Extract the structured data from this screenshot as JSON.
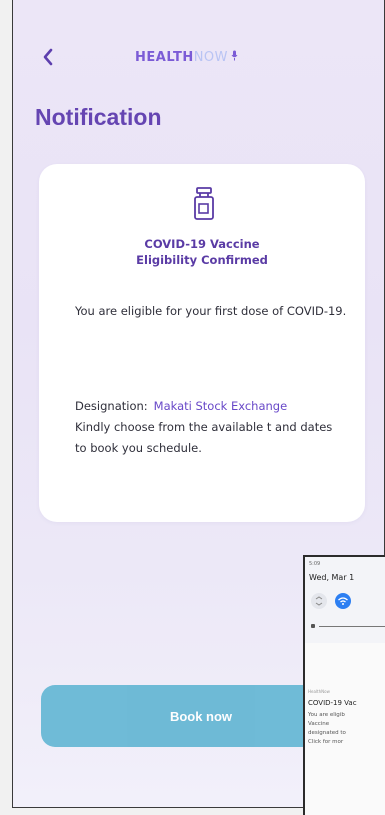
{
  "header": {
    "back_icon": "chevron-left-icon",
    "brand_health": "HEALTH",
    "brand_now": "NOW",
    "brand_icon": "microphone-icon"
  },
  "page_title": "Notification",
  "card": {
    "icon": "vaccine-vial-icon",
    "title_line1": "COVID-19 Vaccine",
    "title_line2": "Eligibility Confirmed",
    "paragraph1": "You are eligible for your first dose of COVID-19.",
    "designation_label": "Designation:",
    "designation_value": "Makati Stock Exchange",
    "paragraph3": "Kindly choose from the available t and dates to book you schedule."
  },
  "book_button_label": "Book now",
  "overlay": {
    "time": "5:09",
    "date": "Wed, Mar 1",
    "notification_app": "HealthNow",
    "notification_title": "COVID-19 Vac",
    "notification_body": "You are eligib\nVaccine\ndesignated to\nClick for mor",
    "accent_color": "#2d7ff2"
  },
  "colors": {
    "brand_purple": "#6545b2",
    "button_blue": "#64b6d4",
    "background": "#ece6f7"
  }
}
